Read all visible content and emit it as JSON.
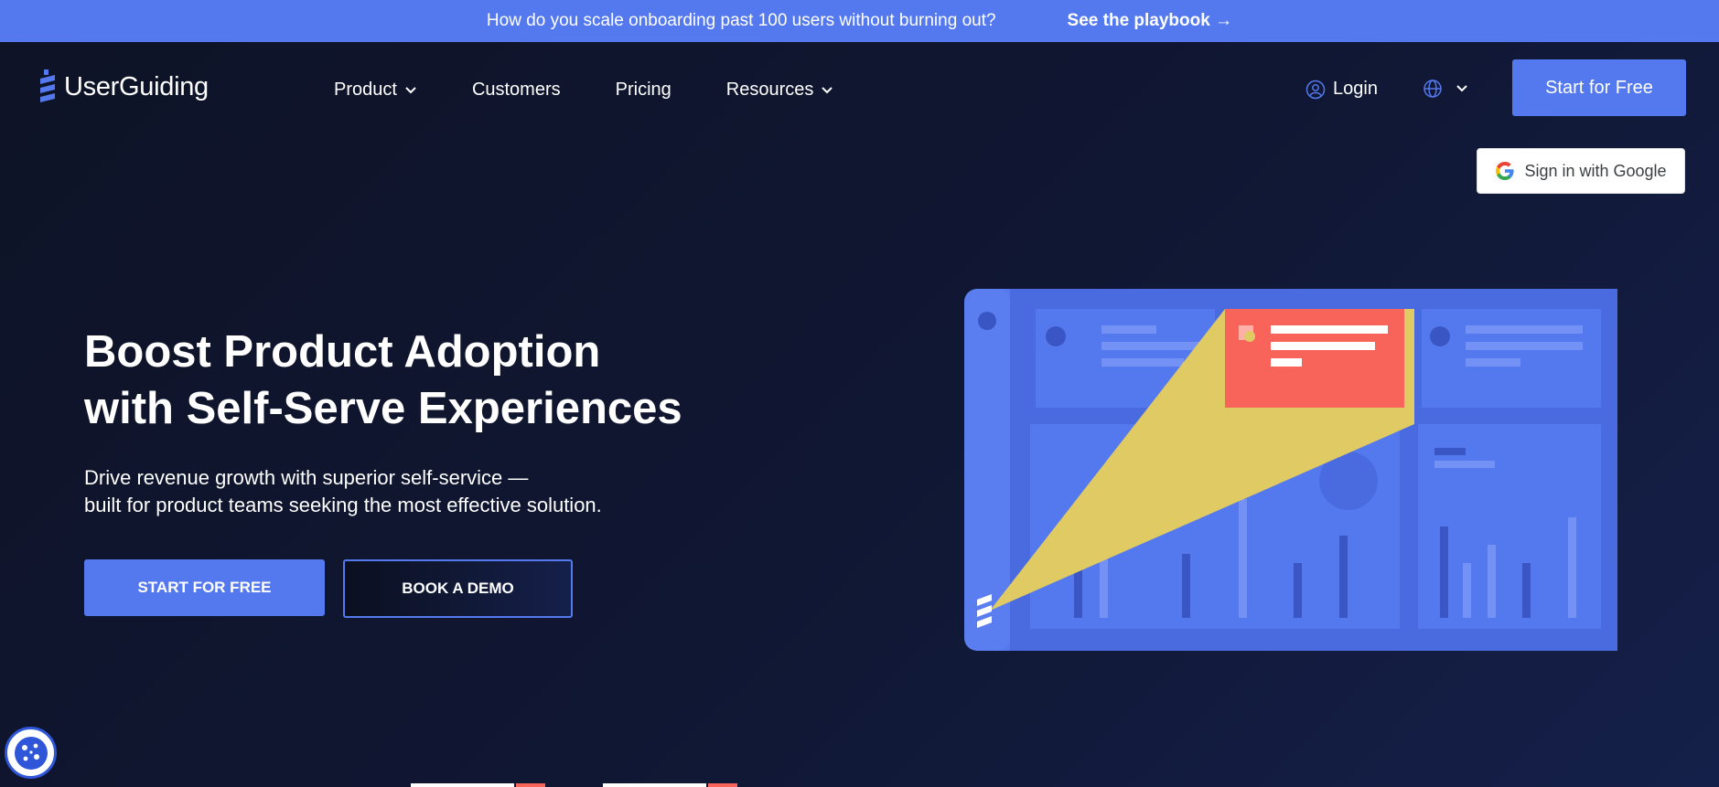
{
  "banner": {
    "message": "How do you scale onboarding past 100 users without burning out?",
    "cta": "See the playbook →"
  },
  "logo": {
    "name": "UserGuiding"
  },
  "nav": {
    "items": [
      {
        "label": "Product",
        "has_dropdown": true
      },
      {
        "label": "Customers",
        "has_dropdown": false
      },
      {
        "label": "Pricing",
        "has_dropdown": false
      },
      {
        "label": "Resources",
        "has_dropdown": true
      }
    ]
  },
  "header": {
    "login_label": "Login",
    "login_icon": "user-icon",
    "language_icon": "globe-icon",
    "start_free_label": "Start for Free",
    "google_label": "Sign in with Google"
  },
  "hero": {
    "title_line1": "Boost Product Adoption",
    "title_line2": "with Self-Serve Experiences",
    "subtitle_line1": "Drive revenue growth with superior self-service —",
    "subtitle_line2": "built for product teams seeking the most effective solution.",
    "primary_cta": "START FOR FREE",
    "secondary_cta": "BOOK A DEMO"
  },
  "colors": {
    "accent": "#5479ee",
    "background": "#0e1326",
    "spotlight": "#dfca63",
    "tooltip": "#f8645a"
  },
  "cookie_icon": "cookie-icon"
}
